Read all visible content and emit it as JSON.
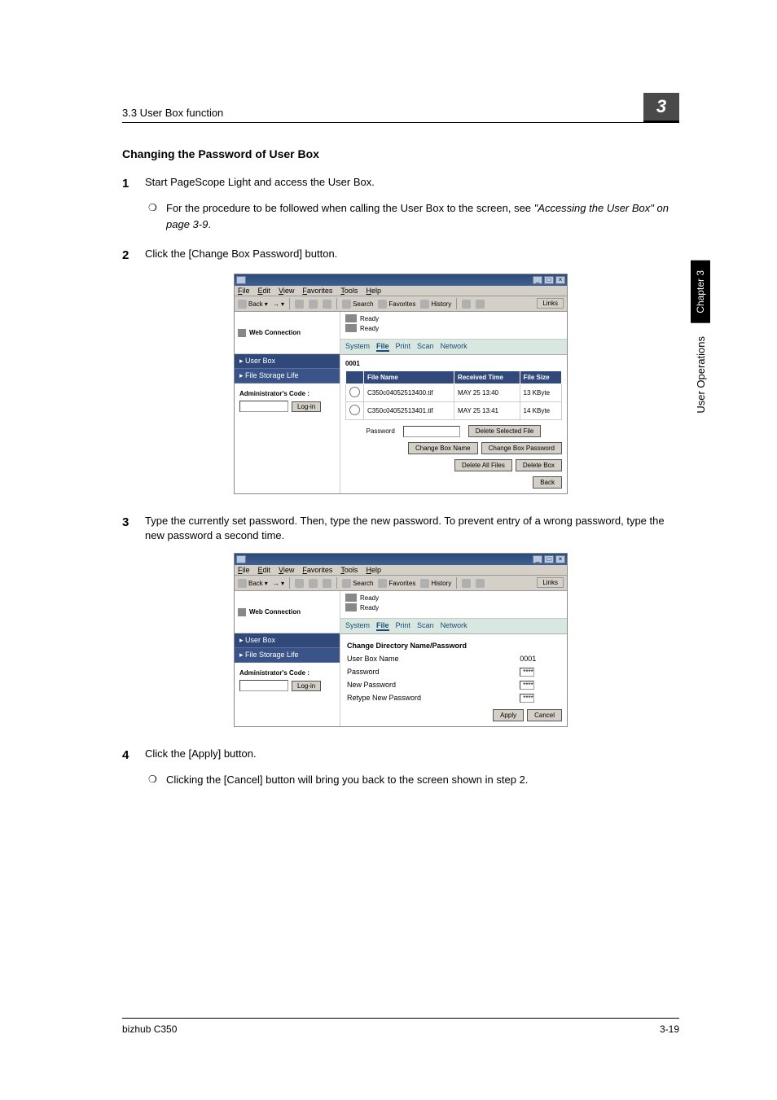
{
  "header": {
    "section": "3.3 User Box function",
    "badge": "3"
  },
  "side": {
    "chapter": "Chapter 3",
    "label": "User Operations"
  },
  "title": "Changing the Password of User Box",
  "steps": {
    "1": "Start PageScope Light and access the User Box.",
    "1_sub": "For the procedure to be followed when calling the User Box to the screen, see ",
    "1_sub_ref": "\"Accessing the User Box\" on page 3-9",
    "1_sub_tail": ".",
    "2": "Click the [Change Box Password] button.",
    "3": "Type the currently set password. Then, type the new password. To prevent entry of a wrong password, type the new password a second time.",
    "4": "Click the [Apply] button.",
    "4_sub": "Clicking the [Cancel] button will bring you back to the screen shown in step 2."
  },
  "browser": {
    "menus": [
      "File",
      "Edit",
      "View",
      "Favorites",
      "Tools",
      "Help"
    ],
    "toolbar": {
      "back": "Back",
      "search": "Search",
      "favorites": "Favorites",
      "history": "History",
      "links": "Links"
    },
    "banner": "Web Connection",
    "status1": "Ready",
    "status2": "Ready",
    "tabs": [
      "System",
      "File",
      "Print",
      "Scan",
      "Network"
    ],
    "nav": {
      "userbox": "User Box",
      "storage": "File Storage Life"
    },
    "admin": {
      "label": "Administrator's Code :",
      "login": "Log-in"
    }
  },
  "shot1": {
    "boxnum": "0001",
    "headers": {
      "c1": "",
      "c2": "File Name",
      "c3": "Received Time",
      "c4": "File Size"
    },
    "rows": [
      {
        "name": "C350c04052513400.tif",
        "time": "MAY 25 13:40",
        "size": "13 KByte"
      },
      {
        "name": "C350c04052513401.tif",
        "time": "MAY 25 13:41",
        "size": "14 KByte"
      }
    ],
    "pw_label": "Password",
    "buttons": {
      "delfile": "Delete Selected File",
      "chgname": "Change Box Name",
      "chgpw": "Change Box Password",
      "delall": "Delete All Files",
      "delbox": "Delete Box",
      "back": "Back"
    }
  },
  "shot2": {
    "form_title": "Change Directory Name/Password",
    "rows": {
      "r1l": "User Box Name",
      "r1v": "0001",
      "r2l": "Password",
      "r2v": "****",
      "r3l": "New Password",
      "r3v": "****",
      "r4l": "Retype New Password",
      "r4v": "****"
    },
    "apply": "Apply",
    "cancel": "Cancel"
  },
  "footer": {
    "left": "bizhub C350",
    "right": "3-19"
  }
}
